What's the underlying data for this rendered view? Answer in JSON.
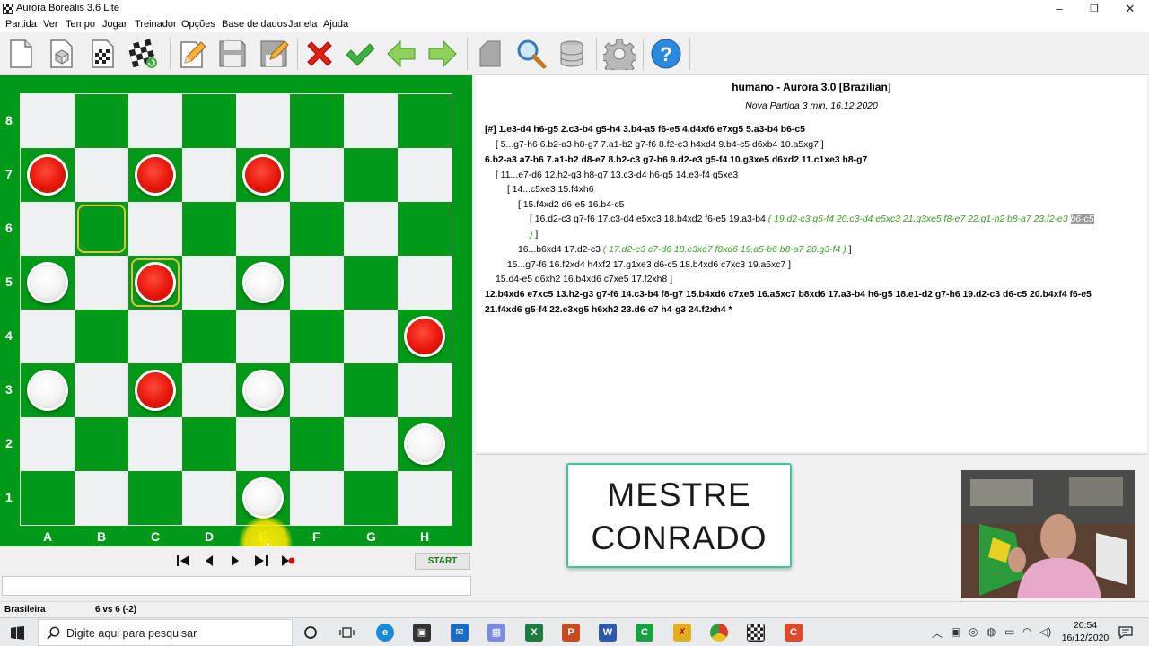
{
  "window": {
    "title": "Aurora Borealis 3.6 Lite",
    "minimize": "–",
    "restore": "❐",
    "close": "✕"
  },
  "menu": [
    "Partida",
    "Ver",
    "Tempo",
    "Jogar",
    "Treinador",
    "Opções",
    "Base de dados",
    "Janela",
    "Ajuda"
  ],
  "toolbar": [
    "new-game",
    "3d-board",
    "board-grid",
    "board-refresh",
    "edit",
    "save",
    "save-edit",
    "cancel",
    "confirm",
    "back-arrow",
    "forward-arrow",
    "database-tag",
    "search",
    "database",
    "settings",
    "help"
  ],
  "board": {
    "files": [
      "A",
      "B",
      "C",
      "D",
      "E",
      "F",
      "G",
      "H"
    ],
    "ranks": [
      "8",
      "7",
      "6",
      "5",
      "4",
      "3",
      "2",
      "1"
    ],
    "pieces": [
      {
        "square": "a7",
        "color": "red"
      },
      {
        "square": "c7",
        "color": "red"
      },
      {
        "square": "e7",
        "color": "red"
      },
      {
        "square": "a5",
        "color": "white"
      },
      {
        "square": "c5",
        "color": "red"
      },
      {
        "square": "e5",
        "color": "white"
      },
      {
        "square": "h4",
        "color": "red"
      },
      {
        "square": "a3",
        "color": "white"
      },
      {
        "square": "c3",
        "color": "red"
      },
      {
        "square": "e3",
        "color": "white"
      },
      {
        "square": "h2",
        "color": "white"
      },
      {
        "square": "e1",
        "color": "white"
      }
    ],
    "highlights": [
      "b6",
      "c5"
    ]
  },
  "nav": {
    "start_label": "START"
  },
  "status": {
    "variant": "Brasileira",
    "score": "6 vs 6  (-2)"
  },
  "notation": {
    "header": "humano - Aurora 3.0 [Brazilian]",
    "subheader": "Nova Partida 3 min, 16.12.2020",
    "lines": {
      "l1": "[#] 1.e3-d4 h6-g5 2.c3-b4 g5-h4 3.b4-a5 f6-e5 4.d4xf6 e7xg5 5.a3-b4 b6-c5",
      "l2": "[ 5...g7-h6 6.b2-a3 h8-g7 7.a1-b2 g7-f6 8.f2-e3 h4xd4 9.b4-c5 d6xb4 10.a5xg7 ]",
      "l3": "6.b2-a3 a7-b6 7.a1-b2 d8-e7 8.b2-c3 g7-h6 9.d2-e3 g5-f4 10.g3xe5 d6xd2 11.c1xe3 h8-g7",
      "l4": "[ 11...e7-d6 12.h2-g3 h8-g7 13.c3-d4 h6-g5 14.e3-f4 g5xe3",
      "l5": "[ 14...c5xe3 15.f4xh6",
      "l6": "[ 15.f4xd2 d6-e5 16.b4-c5",
      "l7a": "[ 16.d2-c3 g7-f6 17.c3-d4 e5xc3 18.b4xd2 f6-e5 19.a3-b4",
      "l7b": "( 19.d2-c3 g5-f4 20.c3-d4 e5xc3 21.g3xe5 f8-e7 22.g1-h2 b8-a7 23.f2-e3",
      "l7c": "b6-c5",
      "l8a": ")",
      "l8b": "]",
      "l9a": "16...b6xd4 17.d2-c3",
      "l9b": "( 17.d2-e3 c7-d6 18.e3xe7 f8xd6 19.a5-b6 b8-a7 20.g3-f4 )",
      "l9c": "]",
      "l10": "15...g7-f6 16.f2xd4 h4xf2 17.g1xe3 d6-c5 18.b4xd6 c7xc3 19.a5xc7 ]",
      "l11": "15.d4-e5 d6xh2 16.b4xd6 c7xe5 17.f2xh8 ]",
      "l12": "12.b4xd6 e7xc5 13.h2-g3 g7-f6 14.c3-b4 f8-g7 15.b4xd6 c7xe5 16.a5xc7 b8xd6 17.a3-b4 h6-g5 18.e1-d2 g7-h6 19.d2-c3 d6-c5 20.b4xf4 f6-e5",
      "l13": "21.f4xd6 g5-f4 22.e3xg5 h6xh2 23.d6-c7 h4-g3 24.f2xh4  *"
    }
  },
  "brand": {
    "line1": "MESTRE",
    "line2": "CONRADO"
  },
  "taskbar": {
    "search_placeholder": "Digite aqui para pesquisar",
    "time": "20:54",
    "date": "16/12/2020"
  },
  "colors": {
    "board_dark": "#009a18",
    "board_light": "#eef0f2",
    "red_piece": "#e8160a",
    "variation_green": "#38a020"
  }
}
